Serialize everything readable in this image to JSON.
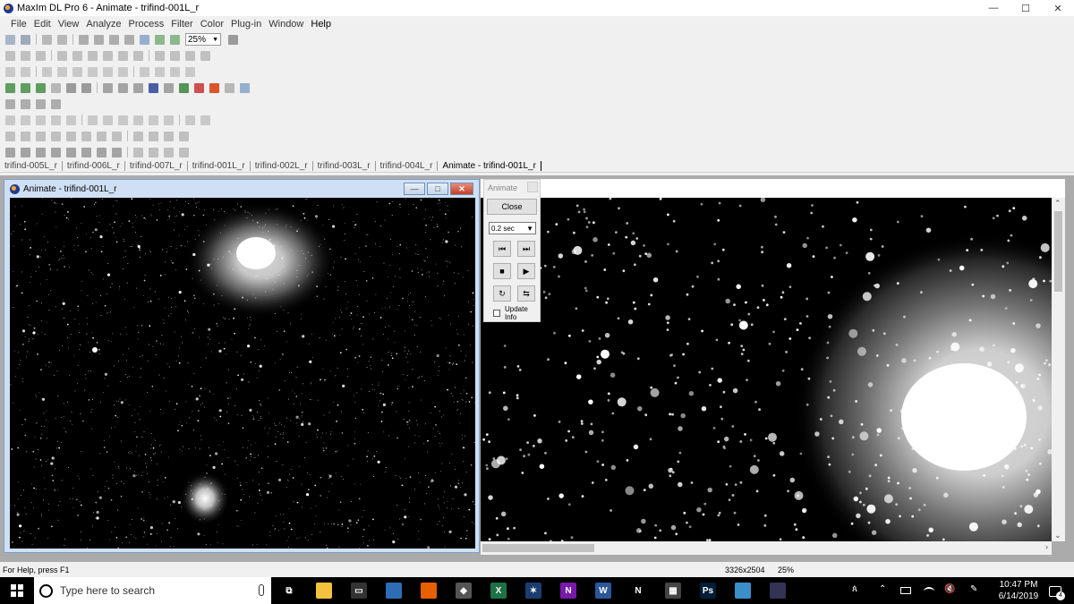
{
  "window": {
    "title": "MaxIm DL Pro 6 - Animate - trifind-001L_r",
    "controls": {
      "minimize": "—",
      "maximize": "☐",
      "close": "✕"
    }
  },
  "menu": [
    "File",
    "Edit",
    "View",
    "Analyze",
    "Process",
    "Filter",
    "Color",
    "Plug-in",
    "Window",
    "Help"
  ],
  "toolbar": {
    "zoom_value": "25%",
    "zoom_arrow": "▼"
  },
  "tabs": [
    "trifind-005L_r",
    "trifind-006L_r",
    "trifind-007L_r",
    "trifind-001L_r",
    "trifind-002L_r",
    "trifind-003L_r",
    "trifind-004L_r",
    "Animate - trifind-001L_r"
  ],
  "child_window": {
    "title": "Animate - trifind-001L_r",
    "btn_min": "—",
    "btn_max": "□",
    "btn_close": "✕"
  },
  "animate_dialog": {
    "title": "Animate",
    "close_label": "Close",
    "interval": "0.2 sec",
    "interval_arrow": "▼",
    "prev_icon": "⏮",
    "next_icon": "⏭",
    "stop_icon": "■",
    "play_icon": "▶",
    "loop_icon": "↻",
    "bounce_icon": "⇆",
    "update_info_label": "Update Info"
  },
  "scrollbars": {
    "up": "⌃",
    "down": "⌄",
    "left": "‹",
    "right": "›"
  },
  "status": {
    "help": "For Help, press F1",
    "dimensions": "3326x2504",
    "zoom": "25%"
  },
  "taskbar": {
    "search_placeholder": "Type here to search",
    "tray_people": "ጰ",
    "tray_chevron": "⌃",
    "tray_volume": "🔇",
    "tray_pen": "✎",
    "time": "10:47 PM",
    "date": "6/14/2019",
    "notifications": "4",
    "apps": [
      {
        "name": "task-view",
        "color": "#000000",
        "glyph": "⧉"
      },
      {
        "name": "file-explorer",
        "color": "#f4c23c",
        "glyph": ""
      },
      {
        "name": "connect",
        "color": "#333333",
        "glyph": "▭"
      },
      {
        "name": "active-app",
        "color": "#2d6db5",
        "glyph": ""
      },
      {
        "name": "firefox",
        "color": "#e66000",
        "glyph": ""
      },
      {
        "name": "app-generic",
        "color": "#555555",
        "glyph": "◆"
      },
      {
        "name": "excel",
        "color": "#1e7145",
        "glyph": "X"
      },
      {
        "name": "app-star",
        "color": "#1a3d70",
        "glyph": "✶"
      },
      {
        "name": "onenote",
        "color": "#7719aa",
        "glyph": "N"
      },
      {
        "name": "word",
        "color": "#2b579a",
        "glyph": "W"
      },
      {
        "name": "netflix",
        "color": "#000000",
        "glyph": "N"
      },
      {
        "name": "calculator",
        "color": "#444444",
        "glyph": "▦"
      },
      {
        "name": "photoshop",
        "color": "#001e36",
        "glyph": "Ps"
      },
      {
        "name": "app-paper",
        "color": "#3a8fc9",
        "glyph": ""
      },
      {
        "name": "maxim-dl",
        "color": "#333355",
        "glyph": ""
      }
    ]
  }
}
